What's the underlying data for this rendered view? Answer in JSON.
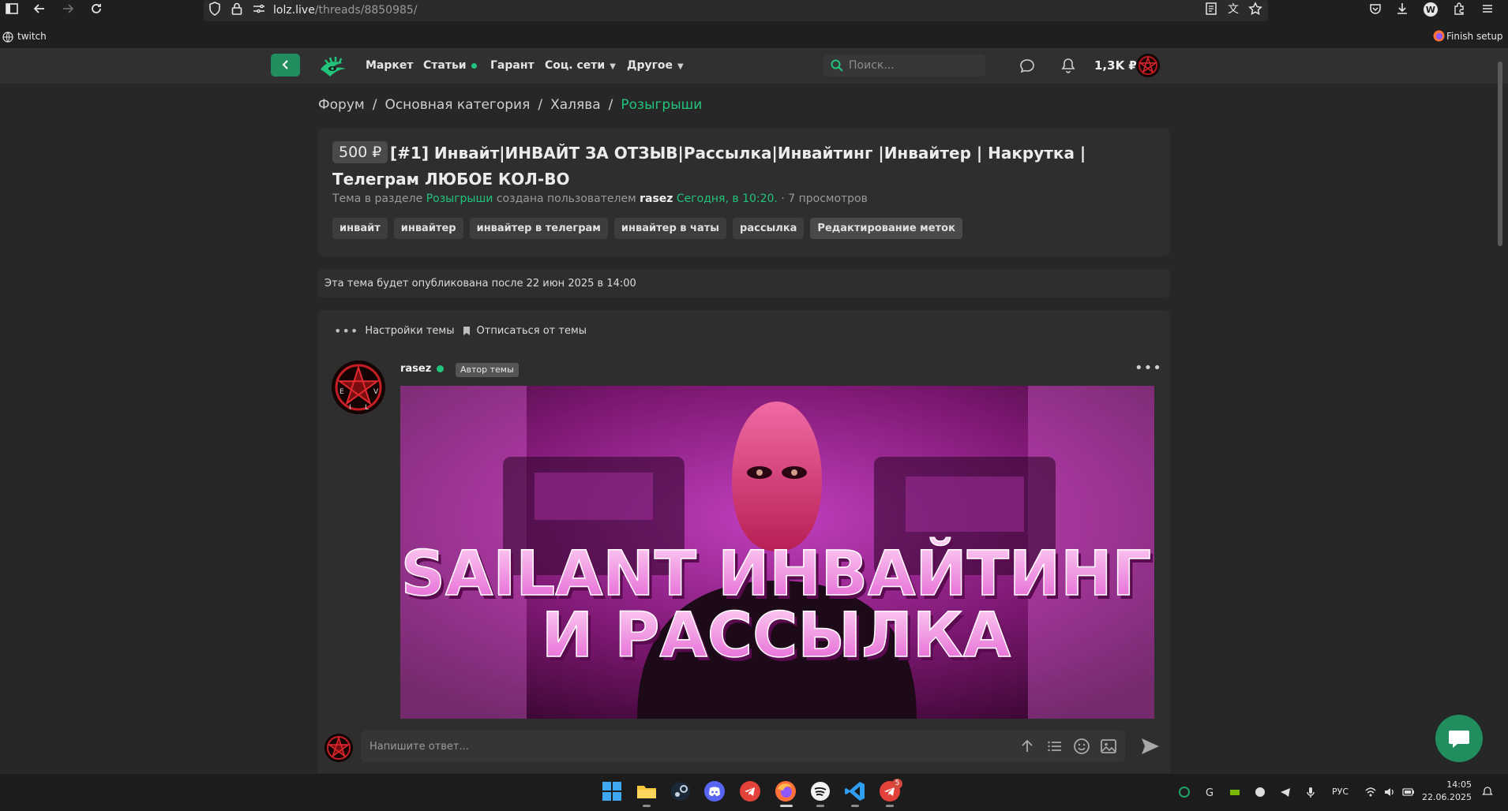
{
  "browser": {
    "url_host": "lolz.live",
    "url_path": "/threads/8850985/",
    "bookmark_twitch": "twitch",
    "finish_setup": "Finish setup"
  },
  "header": {
    "nav": [
      "Маркет",
      "Статьи",
      "Гарант",
      "Соц. сети",
      "Другое"
    ],
    "search_placeholder": "Поиск...",
    "balance": "1,3K ₽"
  },
  "breadcrumb": [
    "Форум",
    "Основная категория",
    "Халява",
    "Розыгрыши"
  ],
  "thread": {
    "price": "500 ₽",
    "title": "[#1] Инвайт|ИНВАЙТ ЗА ОТЗЫВ|Рассылка|Инвайтинг |Инвайтер | Накрутка |Телеграм ЛЮБОЕ КОЛ-ВО",
    "meta_prefix": "Тема в разделе",
    "meta_section": "Розыгрыши",
    "meta_created_by": "создана пользователем",
    "meta_user": "rasez",
    "meta_time": "Сегодня, в 10:20.",
    "meta_views": "· 7 просмотров",
    "tags": [
      "инвайт",
      "инвайтер",
      "инвайтер в телеграм",
      "инвайтер в чаты",
      "рассылка"
    ],
    "edit_tags": "Редактирование меток"
  },
  "notice": "Эта тема будет опубликована после 22 июн 2025 в 14:00",
  "thread_actions": {
    "settings": "Настройки темы",
    "unsubscribe": "Отписаться от темы"
  },
  "post": {
    "username": "rasez",
    "author_badge": "Автор темы",
    "banner_line1": "SAILANT ИНВАЙТИНГ",
    "banner_line2": "И РАССЫЛКА"
  },
  "reply": {
    "placeholder": "Напишите ответ..."
  },
  "taskbar": {
    "lang": "РУС",
    "time": "14:05",
    "date": "22.06.2025",
    "telegram_badge": "5"
  },
  "colors": {
    "accent": "#22c37b",
    "button_green": "#228e5d",
    "background": "#272727",
    "card": "#2e2e2e"
  }
}
